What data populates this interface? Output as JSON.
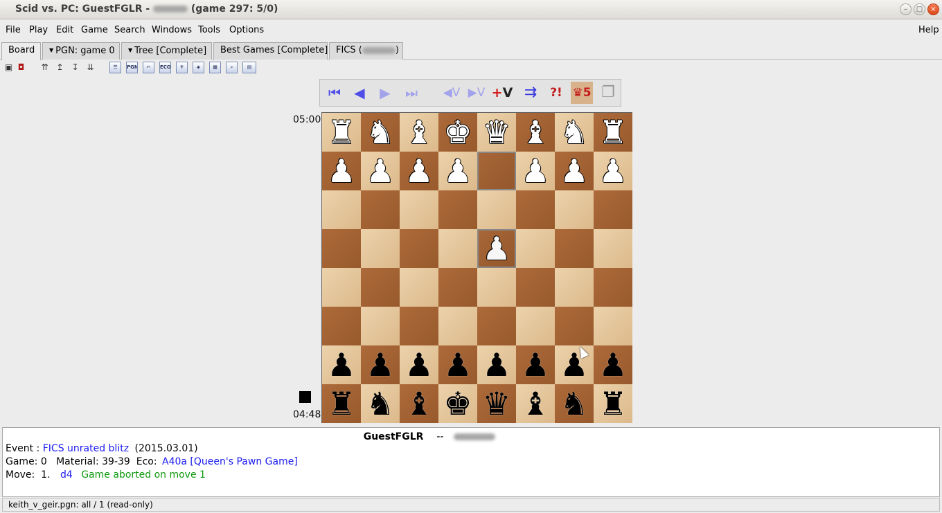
{
  "window": {
    "title_prefix": "Scid vs. PC: GuestFGLR -",
    "title_suffix": "(game 297: 5/0)",
    "controls": {
      "minimize": "–",
      "maximize": "□",
      "close": "×"
    }
  },
  "menubar": {
    "items": [
      "File",
      "Play",
      "Edit",
      "Game",
      "Search",
      "Windows",
      "Tools",
      "Options"
    ],
    "help": "Help"
  },
  "tabs": [
    {
      "label": "Board",
      "dropdown": false
    },
    {
      "label": "PGN: game 0",
      "dropdown": true
    },
    {
      "label": "Tree [Complete]",
      "dropdown": true
    },
    {
      "label": "Best Games [Complete]",
      "dropdown": false
    },
    {
      "label": "FICS (",
      "dropdown": false
    }
  ],
  "toolbar": {
    "icons": [
      "save-icon",
      "bookmark-icon",
      "move-top-icon",
      "move-up-icon",
      "move-down-icon",
      "move-bottom-icon",
      "gamelist-icon",
      "pgn-icon",
      "tools-icon",
      "eco-icon",
      "tree-icon",
      "crosstable-icon",
      "pattern-icon",
      "finder-icon",
      "fics-icon"
    ],
    "pgn_text": "PGN",
    "eco_text": "ECO"
  },
  "nav": {
    "start": "⏮",
    "back": "◀",
    "forward": "▶",
    "end": "⏭",
    "var_back": "◀V",
    "var_forward": "▶V",
    "add_var": "+V",
    "annotate_text": "?!",
    "tb_text": "♛5"
  },
  "clocks": {
    "top": "05:00",
    "bottom": "04:48"
  },
  "board": {
    "rows": [
      [
        "♜",
        "♞",
        "♝",
        "♚",
        "♛",
        "♝",
        "♞",
        "♜"
      ],
      [
        "♟",
        "♟",
        "♟",
        "♟",
        "",
        "♟",
        "♟",
        "♟"
      ],
      [
        "",
        "",
        "",
        "",
        "",
        "",
        "",
        ""
      ],
      [
        "",
        "",
        "",
        "",
        "♟",
        "",
        "",
        ""
      ],
      [
        "",
        "",
        "",
        "",
        "",
        "",
        "",
        ""
      ],
      [
        "",
        "",
        "",
        "",
        "",
        "",
        "",
        ""
      ],
      [
        "♟",
        "♟",
        "♟",
        "♟",
        "♟",
        "♟",
        "♟",
        "♟"
      ],
      [
        "♜",
        "♞",
        "♝",
        "♚",
        "♛",
        "♝",
        "♞",
        "♜"
      ]
    ],
    "colors": [
      [
        "w",
        "w",
        "w",
        "w",
        "w",
        "w",
        "w",
        "w"
      ],
      [
        "w",
        "w",
        "w",
        "w",
        "",
        "w",
        "w",
        "w"
      ],
      [
        "",
        "",
        "",
        "",
        "",
        "",
        "",
        ""
      ],
      [
        "",
        "",
        "",
        "",
        "w",
        "",
        "",
        ""
      ],
      [
        "",
        "",
        "",
        "",
        "",
        "",
        "",
        ""
      ],
      [
        "",
        "",
        "",
        "",
        "",
        "",
        "",
        ""
      ],
      [
        "b",
        "b",
        "b",
        "b",
        "b",
        "b",
        "b",
        "b"
      ],
      [
        "b",
        "b",
        "b",
        "b",
        "b",
        "b",
        "b",
        "b"
      ]
    ],
    "highlighted_squares": [
      "1,4",
      "3,4"
    ]
  },
  "info": {
    "white_player": "GuestFGLR",
    "separator": "--",
    "event_label": "Event :",
    "event_name": "FICS unrated blitz",
    "event_date": "(2015.03.01)",
    "game_line": "Game: 0   Material: 39-39  Eco:",
    "eco": "A40a [Queen's Pawn Game]",
    "move_label": "Move:  1.",
    "move": "d4",
    "result": "Game aborted on move 1"
  },
  "status": {
    "text": "keith_v_geir.pgn:  all / 1 (read-only)"
  },
  "colors": {
    "link": "#1a1af0",
    "result": "#0e9a0e",
    "light_square": "#e4c59b",
    "dark_square": "#a3623a",
    "nav_blue": "#4f4fe8"
  }
}
